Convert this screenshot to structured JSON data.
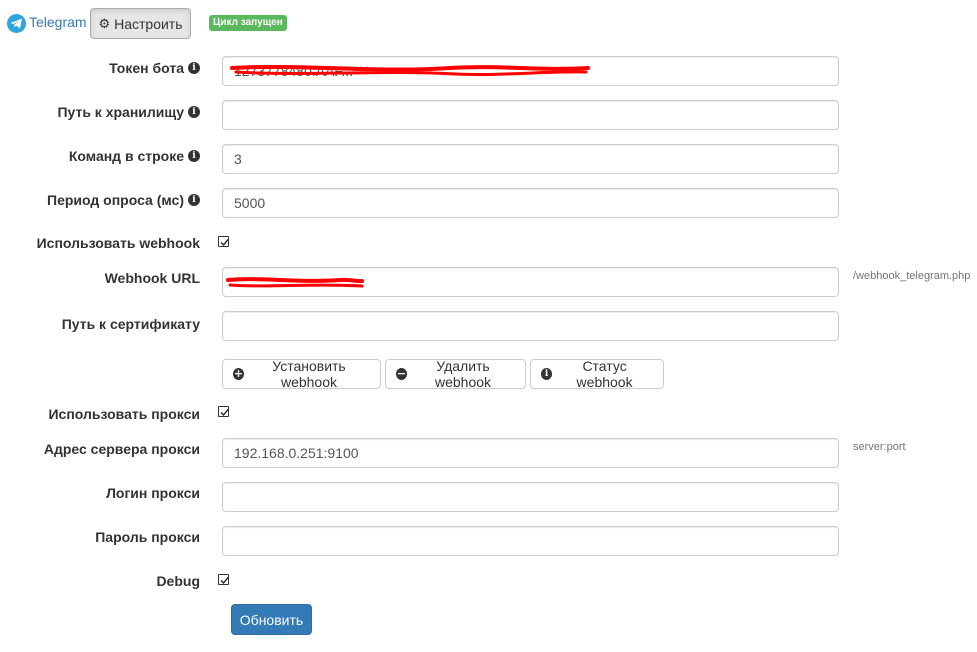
{
  "header": {
    "app_link": "Telegram",
    "configure_label": "Настроить",
    "status_badge": "Цикл запущен"
  },
  "form": {
    "bot_token": {
      "label": "Токен бота",
      "value": "1273778480:AAF...***"
    },
    "storage_path": {
      "label": "Путь к хранилищу",
      "value": ""
    },
    "commands_per_row": {
      "label": "Команд в строке",
      "value": "3"
    },
    "poll_period": {
      "label": "Период опроса (мс)",
      "value": "5000"
    },
    "use_webhook": {
      "label": "Использовать webhook",
      "checked": true
    },
    "webhook_url": {
      "label": "Webhook URL",
      "value": "",
      "hint": "/webhook_telegram.php"
    },
    "cert_path": {
      "label": "Путь к сертификату",
      "value": ""
    },
    "webhook_buttons": {
      "set": "Установить webhook",
      "delete": "Удалить webhook",
      "status": "Статус webhook"
    },
    "use_proxy": {
      "label": "Использовать прокси",
      "checked": true
    },
    "proxy_address": {
      "label": "Адрес сервера прокси",
      "value": "192.168.0.251:9100",
      "hint": "server:port"
    },
    "proxy_login": {
      "label": "Логин прокси",
      "value": ""
    },
    "proxy_password": {
      "label": "Пароль прокси",
      "value": ""
    },
    "debug": {
      "label": "Debug",
      "checked": true
    },
    "submit_label": "Обновить"
  },
  "colors": {
    "link": "#337ab7",
    "primary": "#337ab7",
    "badge": "#5cb85c",
    "redaction": "#ff0000"
  }
}
